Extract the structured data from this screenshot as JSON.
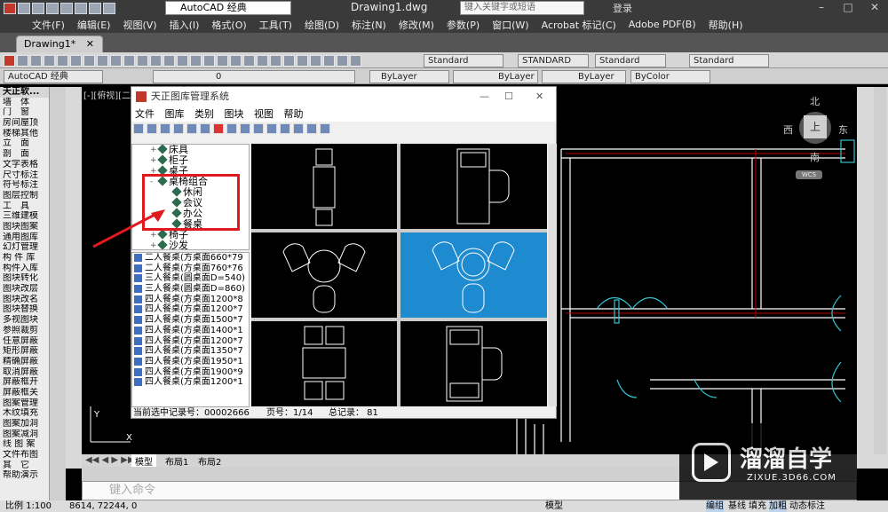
{
  "app": {
    "workspace": "AutoCAD 经典",
    "document_title": "Drawing1.dwg",
    "search_placeholder": "键入关键字或短语",
    "login": "登录"
  },
  "menu": [
    "文件(F)",
    "编辑(E)",
    "视图(V)",
    "插入(I)",
    "格式(O)",
    "工具(T)",
    "绘图(D)",
    "标注(N)",
    "修改(M)",
    "参数(P)",
    "窗口(W)",
    "Acrobat 标记(C)",
    "Adobe PDF(B)",
    "帮助(H)"
  ],
  "doc_tab": "Drawing1*",
  "toolbar": {
    "text_style": "Standard",
    "dim_style": "STANDARD",
    "table_style": "Standard",
    "mleader_style": "Standard",
    "workspace2": "AutoCAD 经典",
    "layer": "0",
    "color": "ByLayer",
    "linetype": "ByLayer",
    "lineweight": "ByLayer",
    "plotstyle": "ByColor"
  },
  "tangent_palette": {
    "title": "天正软...",
    "items": [
      "墙　体",
      "门　窗",
      "房间屋顶",
      "楼梯其他",
      "立　面",
      "剖　面",
      "文字表格",
      "尺寸标注",
      "符号标注",
      "图层控制",
      "工　具",
      "三维建模",
      "图块图案",
      "通用图库",
      "幻灯管理",
      "构 件 库",
      "构件入库",
      "图块转化",
      "图块改层",
      "图块改名",
      "图块替换",
      "多视图块",
      "参照裁剪",
      "任意屏蔽",
      "矩形屏蔽",
      "精确屏蔽",
      "取消屏蔽",
      "屏蔽框开",
      "屏蔽框关",
      "图案管理",
      "木纹填充",
      "图案加洞",
      "图案减洞",
      "线 图 案",
      "文件布图",
      "其　它",
      "帮助演示"
    ]
  },
  "viewcube": {
    "north": "北",
    "south": "南",
    "east": "东",
    "west": "西",
    "top": "上",
    "wcs": "WCS"
  },
  "viewport_label": "[-][俯视][二维",
  "layout_tabs": [
    "模型",
    "布局1",
    "布局2"
  ],
  "command_prompt": "键入命令",
  "status": {
    "scale": "比例 1:100",
    "coords": "8614,  72244,  0",
    "right_labels": [
      "模型",
      "编组",
      "基线",
      "填充",
      "加粗",
      "动态标注"
    ]
  },
  "dialog": {
    "title": "天正图库管理系统",
    "menu": [
      "文件",
      "图库",
      "类别",
      "图块",
      "视图",
      "帮助"
    ],
    "tree": [
      {
        "label": "床具",
        "indent": 1,
        "expand": "+"
      },
      {
        "label": "柜子",
        "indent": 1,
        "expand": "+"
      },
      {
        "label": "桌子",
        "indent": 1,
        "expand": "+"
      },
      {
        "label": "桌椅组合",
        "indent": 1,
        "expand": "-"
      },
      {
        "label": "休闲",
        "indent": 2,
        "expand": ""
      },
      {
        "label": "会议",
        "indent": 2,
        "expand": ""
      },
      {
        "label": "办公",
        "indent": 2,
        "expand": ""
      },
      {
        "label": "餐桌",
        "indent": 2,
        "expand": ""
      },
      {
        "label": "椅子",
        "indent": 1,
        "expand": "+"
      },
      {
        "label": "沙发",
        "indent": 1,
        "expand": "+"
      }
    ],
    "list": [
      "二人餐桌(方桌面660*79",
      "二人餐桌(方桌面760*76",
      "三人餐桌(圆桌面D=540)",
      "三人餐桌(圆桌面D=860)",
      "四人餐桌(方桌面1200*8",
      "四人餐桌(方桌面1200*7",
      "四人餐桌(方桌面1500*7",
      "四人餐桌(方桌面1400*1",
      "四人餐桌(方桌面1200*7",
      "四人餐桌(方桌面1350*7",
      "四人餐桌(方桌面1950*1",
      "四人餐桌(方桌面1900*9",
      "四人餐桌(方桌面1200*1"
    ],
    "status_record": "当前选中记录号：00002666",
    "status_page": "页号：1/14",
    "status_total": "总记录：  81"
  },
  "watermark": {
    "brand": "溜溜自学",
    "url": "ZIXUE.3D66.COM"
  },
  "colors": {
    "accent_red": "#e0191c",
    "selection_blue": "#1e8ad0",
    "wall": "#ffffff",
    "door": "#35c2cf"
  }
}
